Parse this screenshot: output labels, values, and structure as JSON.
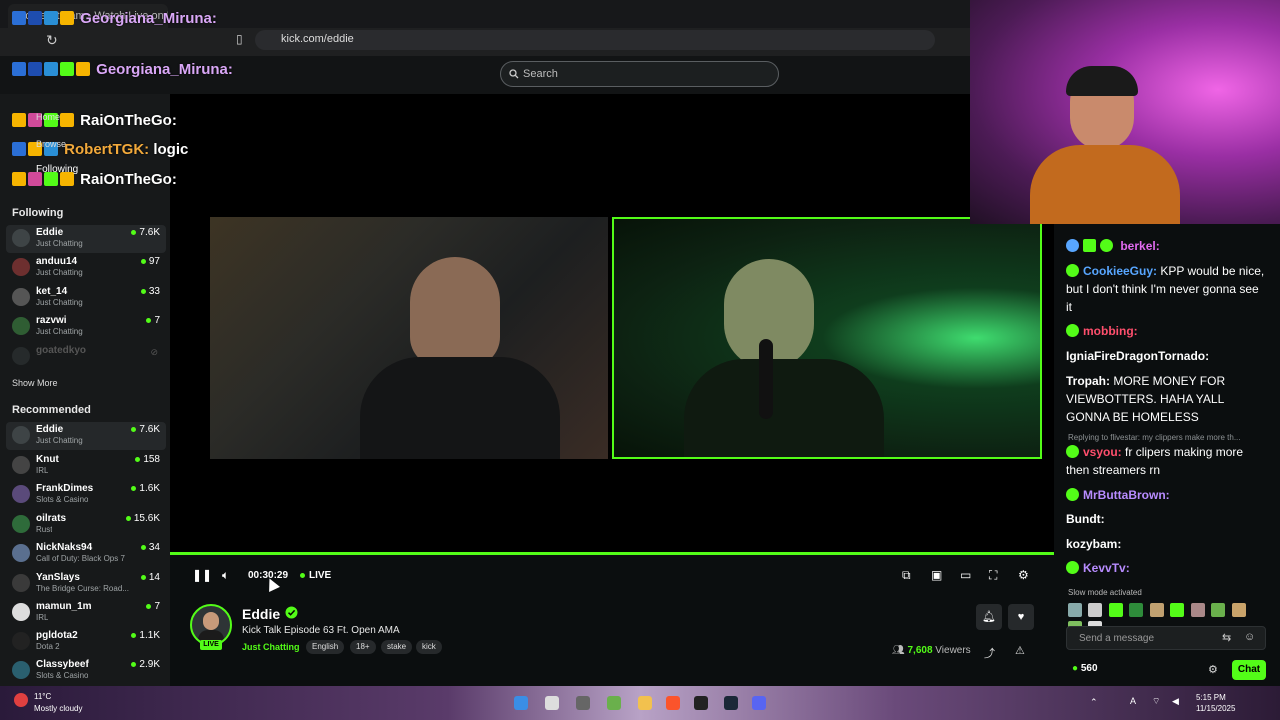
{
  "browser": {
    "tab_title": "Eddie Stream - Watch Live on Kick",
    "url": "kick.com/eddie"
  },
  "search": {
    "placeholder": "Search"
  },
  "overlay_chat": [
    {
      "user": "Georgiana_Miruna:",
      "color": "#d9a7f6",
      "text": ""
    },
    {
      "user": "Georgiana_Miruna:",
      "color": "#d9a7f6",
      "text": ""
    },
    {
      "user": "RaiOnTheGo:",
      "color": "#ffffff",
      "text": ""
    },
    {
      "user": "RobertTGK:",
      "color": "#f2a93b",
      "text": "logic"
    },
    {
      "user": "RaiOnTheGo:",
      "color": "#ffffff",
      "text": ""
    }
  ],
  "sidebar": {
    "nav": {
      "home": "Home",
      "browse": "Browse",
      "following": "Following"
    },
    "following_title": "Following",
    "following": [
      {
        "name": "Eddie",
        "category": "Just Chatting",
        "viewers": "7.6K",
        "active": true
      },
      {
        "name": "anduu14",
        "category": "Just Chatting",
        "viewers": "97"
      },
      {
        "name": "ket_14",
        "category": "Just Chatting",
        "viewers": "33"
      },
      {
        "name": "razvwi",
        "category": "Just Chatting",
        "viewers": "7"
      }
    ],
    "offline": {
      "name": "goatedkyo"
    },
    "show_more": "Show More",
    "recommended_title": "Recommended",
    "recommended": [
      {
        "name": "Eddie",
        "category": "Just Chatting",
        "viewers": "7.6K",
        "active": true
      },
      {
        "name": "Knut",
        "category": "IRL",
        "viewers": "158"
      },
      {
        "name": "FrankDimes",
        "category": "Slots & Casino",
        "viewers": "1.6K"
      },
      {
        "name": "oilrats",
        "category": "Rust",
        "viewers": "15.6K"
      },
      {
        "name": "NickNaks94",
        "category": "Call of Duty: Black Ops 7",
        "viewers": "34"
      },
      {
        "name": "YanSlays",
        "category": "The Bridge Curse: Road...",
        "viewers": "14"
      },
      {
        "name": "mamun_1m",
        "category": "IRL",
        "viewers": "7"
      },
      {
        "name": "pgldota2",
        "category": "Dota 2",
        "viewers": "1.1K"
      },
      {
        "name": "Classybeef",
        "category": "Slots & Casino",
        "viewers": "2.9K"
      }
    ]
  },
  "player": {
    "time": "00:30:29",
    "live": "LIVE",
    "progress": 1.0
  },
  "channel": {
    "name": "Eddie",
    "live_badge": "LIVE",
    "title": "Kick Talk Episode 63 Ft. Open AMA",
    "category": "Just Chatting",
    "tags": [
      "English",
      "18+",
      "stake",
      "kick"
    ],
    "viewers_count": "7,608",
    "viewers_label": "Viewers"
  },
  "chat": {
    "messages": [
      {
        "user": "berkel:",
        "color": "#e26bf0",
        "text": "",
        "badges": 3
      },
      {
        "user": "CookieeGuy:",
        "color": "#58a6ff",
        "text": "KPP would be nice, but I don't think I'm never gonna see it",
        "badges": 1
      },
      {
        "user": "mobbing:",
        "color": "#ff4f6d",
        "text": "",
        "badges": 1
      },
      {
        "user": "IgniaFireDragonTornado:",
        "color": "#ffffff",
        "text": "",
        "badges": 0
      },
      {
        "user": "Tropah:",
        "color": "#ffffff",
        "text": "MORE MONEY FOR VIEWBOTTERS. HAHA YALL GONNA BE HOMELESS",
        "badges": 0
      },
      {
        "user": "vsyou:",
        "color": "#ff4f6d",
        "text": "fr clipers making more then streamers rn",
        "badges": 1
      },
      {
        "user": "MrButtaBrown:",
        "color": "#b88cff",
        "text": "",
        "badges": 1
      },
      {
        "user": "Bundt:",
        "color": "#ffffff",
        "text": "",
        "badges": 0
      },
      {
        "user": "kozybam:",
        "color": "#ffffff",
        "text": "",
        "badges": 0
      },
      {
        "user": "KevvTv:",
        "color": "#b88cff",
        "text": "",
        "badges": 1
      }
    ],
    "reply_note": "Replying to flivestar: my clippers make more th...",
    "slow_mode": "Slow mode activated",
    "input_placeholder": "Send a message",
    "points": "560",
    "send_label": "Chat"
  },
  "taskbar": {
    "temperature": "11°C",
    "weather": "Mostly cloudy",
    "time": "5:15 PM",
    "date": "11/15/2025"
  },
  "colors": {
    "accent": "#53fc18",
    "background": "#0b0e0f",
    "sidebar": "#17191a"
  }
}
